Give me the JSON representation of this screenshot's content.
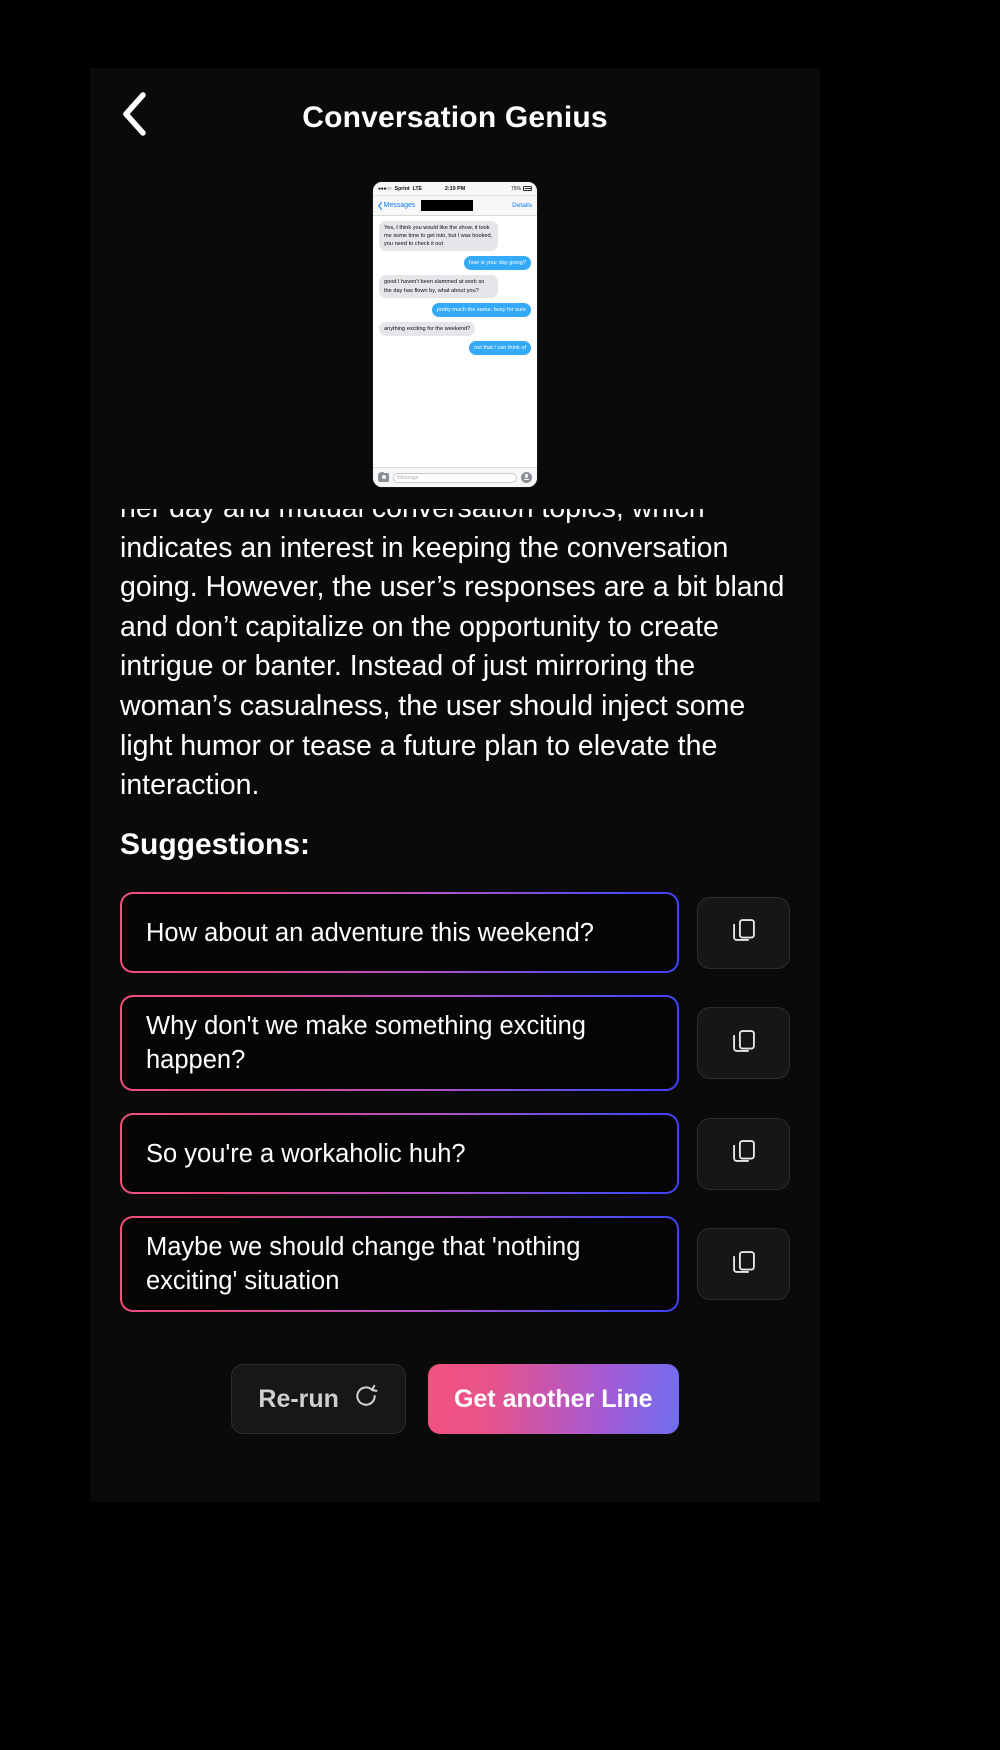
{
  "header": {
    "back_icon": "chevron-left-icon",
    "title": "Conversation Genius"
  },
  "screenshot": {
    "status": {
      "signal_dots": "●●●○○",
      "carrier": "Sprint",
      "network": "LTE",
      "time": "2:19 PM",
      "battery": "75%"
    },
    "nav": {
      "back_label": "Messages",
      "contact_redacted": "",
      "details_label": "Details"
    },
    "messages": [
      {
        "from": "them",
        "text": "Yes, I think you would like the show, it took me some time to get into, but I was hooked, you need to check it out"
      },
      {
        "from": "me",
        "text": "how is your day going?"
      },
      {
        "from": "them",
        "text": "good I haven't been slammed at work so the day has flown by, what about you?"
      },
      {
        "from": "me",
        "text": "pretty much the same, busy for sure"
      },
      {
        "from": "them",
        "text": "anything exciting for the weekend?"
      },
      {
        "from": "me",
        "text": "not that I can think of"
      }
    ],
    "input_placeholder": "iMessage",
    "camera_icon": "camera-icon",
    "mic_icon": "microphone-icon"
  },
  "analysis": {
    "text": "her day and mutual conversation topics, which indicates an interest in keeping the conversation going. However, the user’s responses are a bit bland and don’t capitalize on the opportunity to create intrigue or banter. Instead of just mirroring the woman’s casualness, the user should inject some light humor or tease a future plan to elevate the interaction."
  },
  "suggestions": {
    "heading": "Suggestions:",
    "copy_icon": "copy-icon",
    "items": [
      {
        "text": "How about an adventure this weekend?"
      },
      {
        "text": "Why don't we make something exciting happen?"
      },
      {
        "text": "So you're a workaholic huh?"
      },
      {
        "text": "Maybe we should change that 'nothing exciting' situation"
      }
    ]
  },
  "actions": {
    "rerun_label": "Re-run",
    "rerun_icon": "refresh-icon",
    "another_label": "Get another Line"
  },
  "colors": {
    "background": "#000000",
    "card_gradient_start": "#f0517a",
    "card_gradient_end": "#4040f0",
    "bubble_me": "#34aaf8",
    "bubble_them": "#e5e5ea",
    "ios_blue": "#0b7bff"
  }
}
